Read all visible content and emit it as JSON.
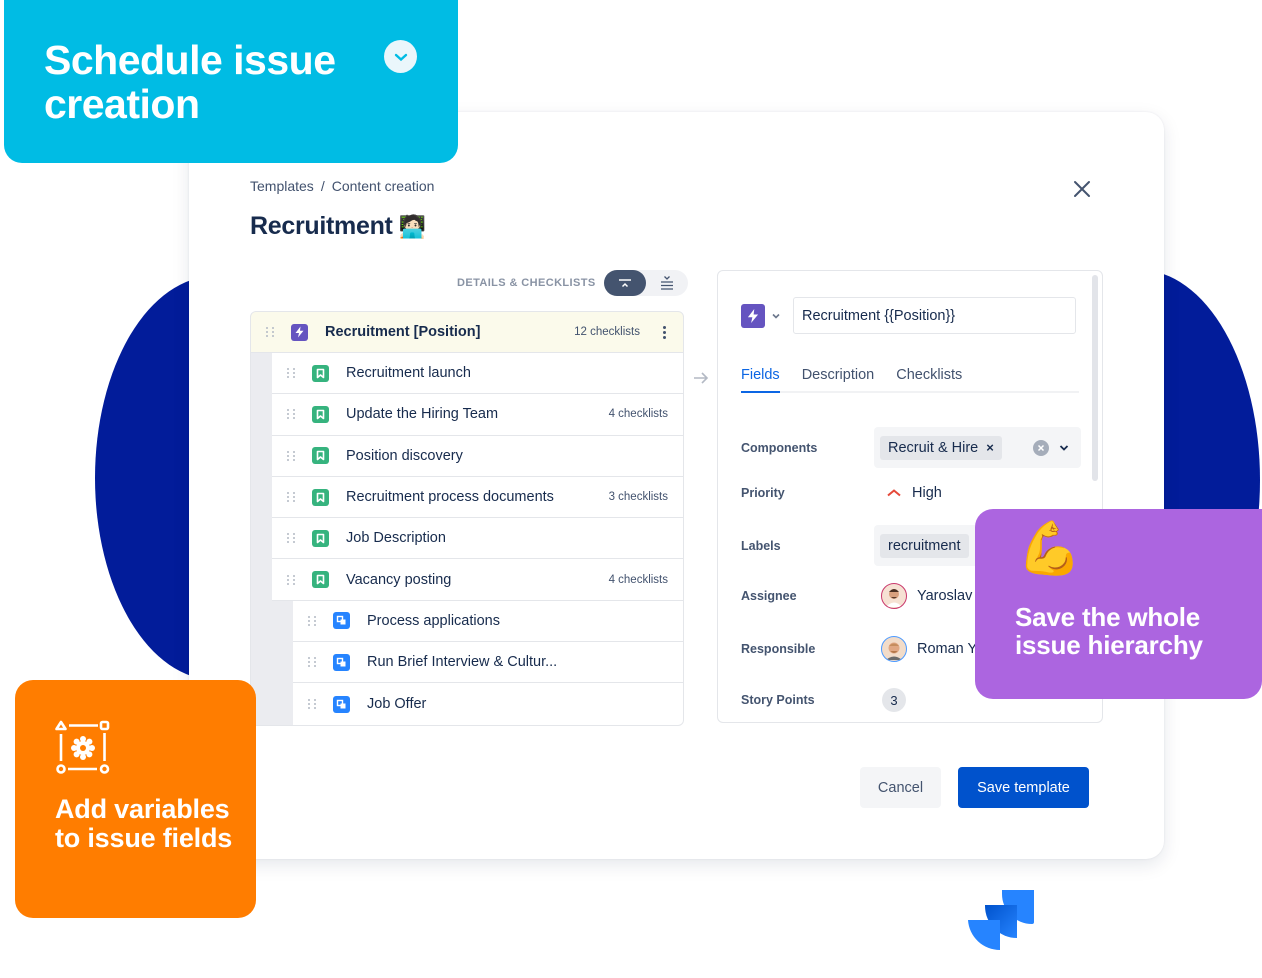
{
  "promo_cards": {
    "schedule": {
      "title": "Schedule issue creation",
      "icon": "check-circle-icon",
      "color": "#00bce4"
    },
    "hierarchy": {
      "emoji": "💪",
      "title": "Save the whole issue hierarchy",
      "color": "#ac65e0"
    },
    "variables": {
      "icon": "variable-settings-icon",
      "title": "Add variables to issue fields",
      "color": "#ff7d00"
    }
  },
  "modal": {
    "breadcrumb": {
      "items": [
        "Templates",
        "Content creation"
      ],
      "separator": "/"
    },
    "title": "Recruitment",
    "title_emoji": "🧑🏻‍💻",
    "close_icon": "close-icon",
    "view_toggle": {
      "label": "DETAILS & CHECKLISTS",
      "options": [
        "collapse-all",
        "expand-all"
      ],
      "active": "collapse-all"
    },
    "tree": {
      "root": {
        "title": "Recruitment [Position]",
        "count": "12 checklists",
        "type": "epic"
      },
      "children": [
        {
          "title": "Recruitment launch",
          "count": "",
          "type": "story",
          "level": 1
        },
        {
          "title": "Update the Hiring Team",
          "count": "4 checklists",
          "type": "story",
          "level": 1
        },
        {
          "title": "Position discovery",
          "count": "",
          "type": "story",
          "level": 1
        },
        {
          "title": "Recruitment process documents",
          "count": "3 checklists",
          "type": "story",
          "level": 1
        },
        {
          "title": "Job Description",
          "count": "",
          "type": "story",
          "level": 1
        },
        {
          "title": "Vacancy posting",
          "count": "4 checklists",
          "type": "story",
          "level": 1
        },
        {
          "title": "Process applications",
          "count": "",
          "type": "subtask",
          "level": 2
        },
        {
          "title": "Run Brief Interview & Cultur...",
          "count": "",
          "type": "subtask",
          "level": 2
        },
        {
          "title": "Job Offer",
          "count": "",
          "type": "subtask",
          "level": 2
        }
      ]
    },
    "detail": {
      "summary_value": "Recruitment {{Position}}",
      "issue_type": "epic",
      "tabs": [
        "Fields",
        "Description",
        "Checklists"
      ],
      "active_tab": "Fields",
      "fields": {
        "components": {
          "label": "Components",
          "value": "Recruit & Hire"
        },
        "priority": {
          "label": "Priority",
          "value": "High",
          "color": "#e5493a"
        },
        "labels": {
          "label": "Labels",
          "value": "recruitment"
        },
        "assignee": {
          "label": "Assignee",
          "value": "Yaroslav"
        },
        "responsible": {
          "label": "Responsible",
          "value": "Roman Y"
        },
        "story_points": {
          "label": "Story Points",
          "value": "3"
        }
      }
    },
    "buttons": {
      "cancel": "Cancel",
      "save": "Save template"
    }
  },
  "colors": {
    "primary": "#0052cc",
    "tab_active": "#0c66e4",
    "epic": "#6554c0",
    "story": "#36b37e",
    "subtask": "#2684ff",
    "background_circle": "#021c9a"
  }
}
